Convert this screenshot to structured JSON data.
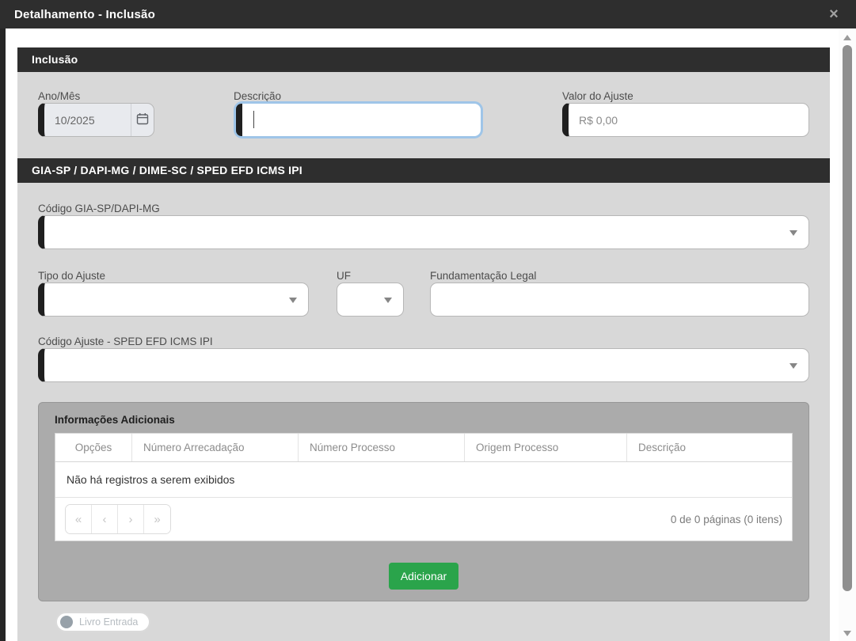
{
  "modal": {
    "title": "Detalhamento - Inclusão",
    "close_glyph": "×"
  },
  "colors": {
    "header_dark": "#2e2e2e",
    "content_gray": "#d8d8d8",
    "panel_gray": "#ababab",
    "focus_blue": "#9fc5e8",
    "accent_green": "#2aa44b"
  },
  "sections": {
    "inclusao": {
      "title": "Inclusão"
    },
    "gia": {
      "title": "GIA-SP / DAPI-MG / DIME-SC / SPED EFD ICMS IPI"
    }
  },
  "fields": {
    "ano_mes": {
      "label": "Ano/Mês",
      "value": "10/2025"
    },
    "descricao": {
      "label": "Descrição",
      "value": ""
    },
    "valor_ajuste": {
      "label": "Valor do Ajuste",
      "placeholder": "R$ 0,00"
    },
    "codigo_gia": {
      "label": "Código GIA-SP/DAPI-MG",
      "value": ""
    },
    "tipo_ajuste": {
      "label": "Tipo do Ajuste",
      "value": ""
    },
    "uf": {
      "label": "UF",
      "value": ""
    },
    "fundamentacao": {
      "label": "Fundamentação Legal",
      "value": ""
    },
    "codigo_sped": {
      "label": "Código Ajuste - SPED EFD ICMS IPI",
      "value": ""
    }
  },
  "panel": {
    "title": "Informações Adicionais",
    "table": {
      "headers": [
        "Opções",
        "Número Arrecadação",
        "Número Processo",
        "Origem Processo",
        "Descrição"
      ],
      "empty_message": "Não há registros a serem exibidos"
    },
    "pagination": {
      "first": "«",
      "prev": "‹",
      "next": "›",
      "last": "»",
      "summary": "0 de 0 páginas (0 itens)"
    },
    "add_button": "Adicionar"
  },
  "footer": {
    "livro_entrada": "Livro Entrada"
  }
}
